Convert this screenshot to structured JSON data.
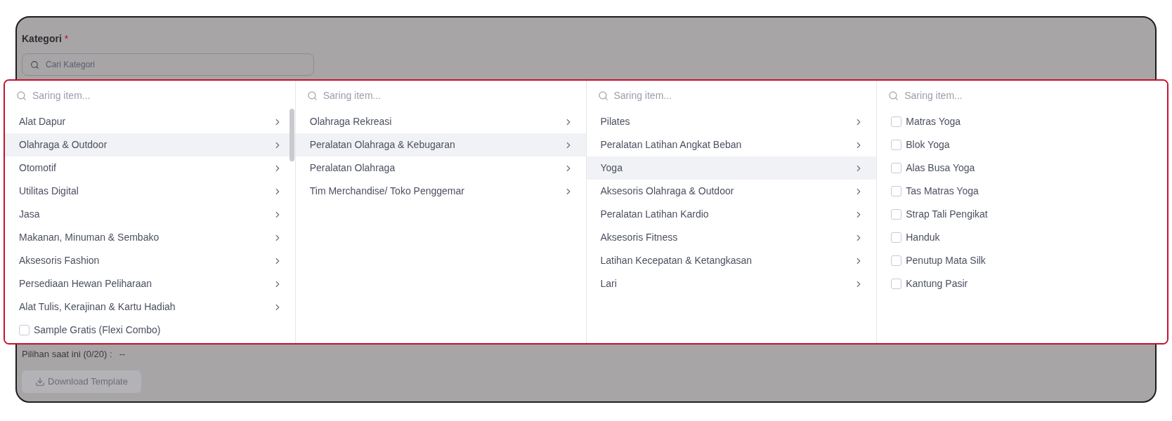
{
  "field": {
    "label": "Kategori",
    "required_mark": "*",
    "placeholder": "Cari Kategori"
  },
  "dropdown": {
    "columns": [
      {
        "filter_placeholder": "Saring item...",
        "scrollable": true,
        "items": [
          {
            "kind": "branch",
            "label": "Alat Dapur",
            "selected": false
          },
          {
            "kind": "branch",
            "label": "Olahraga & Outdoor",
            "selected": true
          },
          {
            "kind": "branch",
            "label": "Otomotif",
            "selected": false
          },
          {
            "kind": "branch",
            "label": "Utilitas Digital",
            "selected": false
          },
          {
            "kind": "branch",
            "label": "Jasa",
            "selected": false
          },
          {
            "kind": "branch",
            "label": "Makanan, Minuman & Sembako",
            "selected": false
          },
          {
            "kind": "branch",
            "label": "Aksesoris Fashion",
            "selected": false
          },
          {
            "kind": "branch",
            "label": "Persediaan Hewan Peliharaan",
            "selected": false
          },
          {
            "kind": "branch",
            "label": "Alat Tulis, Kerajinan & Kartu Hadiah",
            "selected": false
          },
          {
            "kind": "checkbox",
            "label": "Sample Gratis (Flexi Combo)",
            "checked": false
          }
        ]
      },
      {
        "filter_placeholder": "Saring item...",
        "scrollable": false,
        "items": [
          {
            "kind": "branch",
            "label": "Olahraga Rekreasi",
            "selected": false
          },
          {
            "kind": "branch",
            "label": "Peralatan Olahraga & Kebugaran",
            "selected": true
          },
          {
            "kind": "branch",
            "label": "Peralatan Olahraga",
            "selected": false
          },
          {
            "kind": "branch",
            "label": "Tim Merchandise/ Toko Penggemar",
            "selected": false
          }
        ]
      },
      {
        "filter_placeholder": "Saring item...",
        "scrollable": false,
        "items": [
          {
            "kind": "branch",
            "label": "Pilates",
            "selected": false
          },
          {
            "kind": "branch",
            "label": "Peralatan Latihan Angkat Beban",
            "selected": false
          },
          {
            "kind": "branch",
            "label": "Yoga",
            "selected": true
          },
          {
            "kind": "branch",
            "label": "Aksesoris Olahraga & Outdoor",
            "selected": false
          },
          {
            "kind": "branch",
            "label": "Peralatan Latihan Kardio",
            "selected": false
          },
          {
            "kind": "branch",
            "label": "Aksesoris Fitness",
            "selected": false
          },
          {
            "kind": "branch",
            "label": "Latihan Kecepatan & Ketangkasan",
            "selected": false
          },
          {
            "kind": "branch",
            "label": "Lari",
            "selected": false
          }
        ]
      },
      {
        "filter_placeholder": "Saring item...",
        "scrollable": false,
        "items": [
          {
            "kind": "checkbox",
            "label": "Matras Yoga",
            "checked": false
          },
          {
            "kind": "checkbox",
            "label": "Blok Yoga",
            "checked": false
          },
          {
            "kind": "checkbox",
            "label": "Alas Busa Yoga",
            "checked": false
          },
          {
            "kind": "checkbox",
            "label": "Tas Matras Yoga",
            "checked": false
          },
          {
            "kind": "checkbox",
            "label": "Strap Tali Pengikat",
            "checked": false
          },
          {
            "kind": "checkbox",
            "label": "Handuk",
            "checked": false
          },
          {
            "kind": "checkbox",
            "label": "Penutup Mata Silk",
            "checked": false
          },
          {
            "kind": "checkbox",
            "label": "Kantung Pasir",
            "checked": false
          }
        ]
      }
    ]
  },
  "selection": {
    "label": "Pilihan saat ini (0/20) :",
    "value": "--"
  },
  "download_button": {
    "label": "Download Template",
    "disabled": true
  }
}
